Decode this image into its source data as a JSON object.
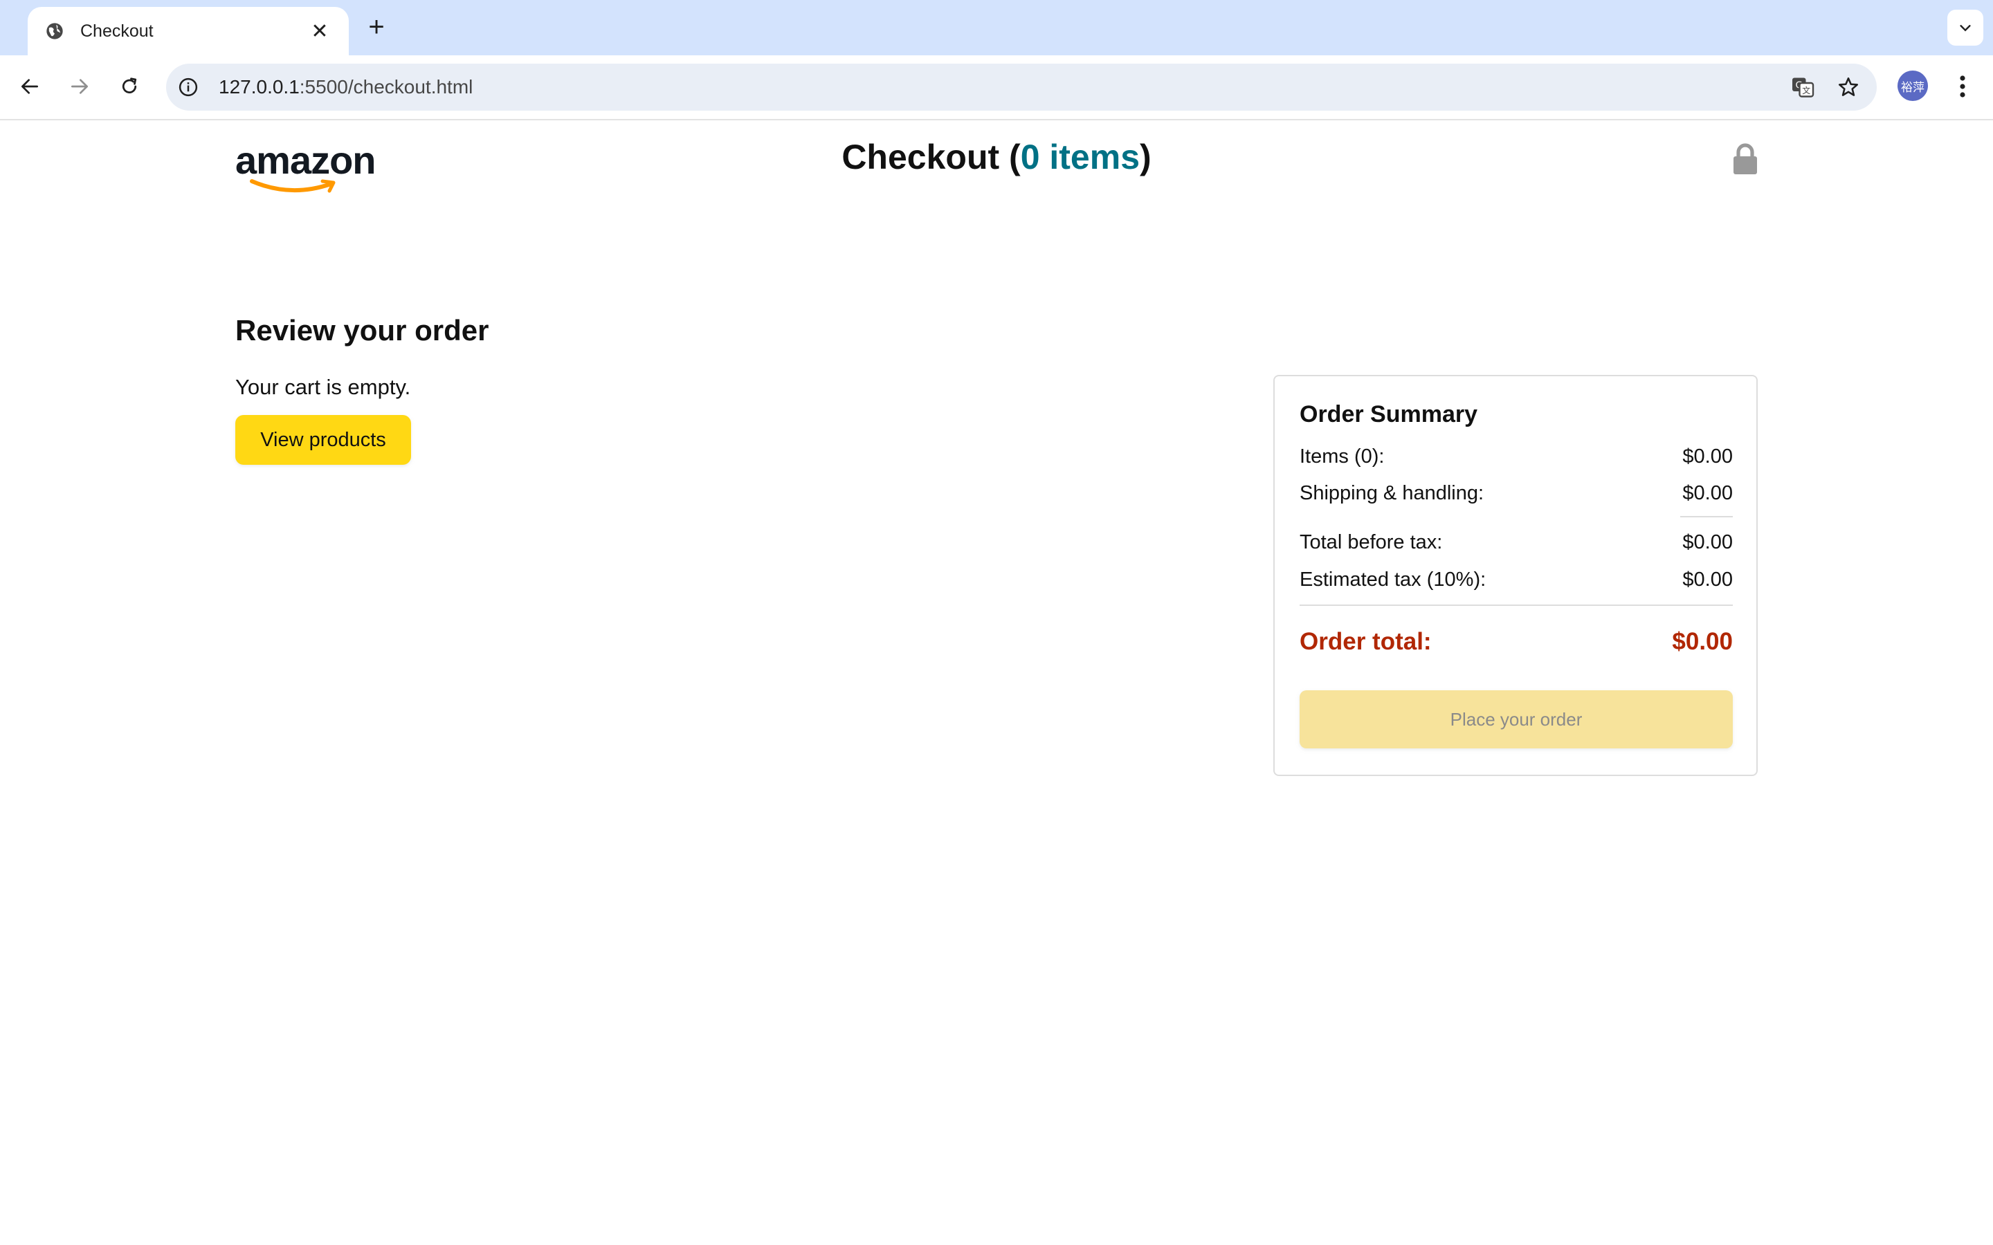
{
  "browser": {
    "tab_title": "Checkout",
    "new_tab_symbol": "+",
    "close_symbol": "✕",
    "url_host": "127.0.0.1",
    "url_path": ":5500/checkout.html",
    "avatar_text": "裕萍"
  },
  "header": {
    "logo_text": "amazon",
    "title_prefix": "Checkout (",
    "item_count_text": "0 items",
    "title_suffix": ")"
  },
  "review": {
    "title": "Review your order",
    "empty_message": "Your cart is empty.",
    "view_products_label": "View products"
  },
  "summary": {
    "title": "Order Summary",
    "items_label": "Items (0):",
    "items_value": "$0.00",
    "shipping_label": "Shipping & handling:",
    "shipping_value": "$0.00",
    "before_tax_label": "Total before tax:",
    "before_tax_value": "$0.00",
    "tax_label": "Estimated tax (10%):",
    "tax_value": "$0.00",
    "total_label": "Order total:",
    "total_value": "$0.00",
    "place_order_label": "Place your order"
  },
  "colors": {
    "tabbar_bg": "#d3e3fd",
    "primary_button": "#ffd814",
    "disabled_button": "#f7e39b",
    "order_total": "#b12704",
    "item_count_link": "#017185",
    "logo_smile": "#ff9900"
  },
  "icons": {
    "tab": "globe-icon",
    "back": "arrow-left-icon",
    "forward": "arrow-right-icon",
    "reload": "reload-icon",
    "site_info": "info-icon",
    "translate": "translate-icon",
    "bookmark": "star-icon",
    "menu": "kebab-menu-icon",
    "secure": "lock-icon"
  }
}
